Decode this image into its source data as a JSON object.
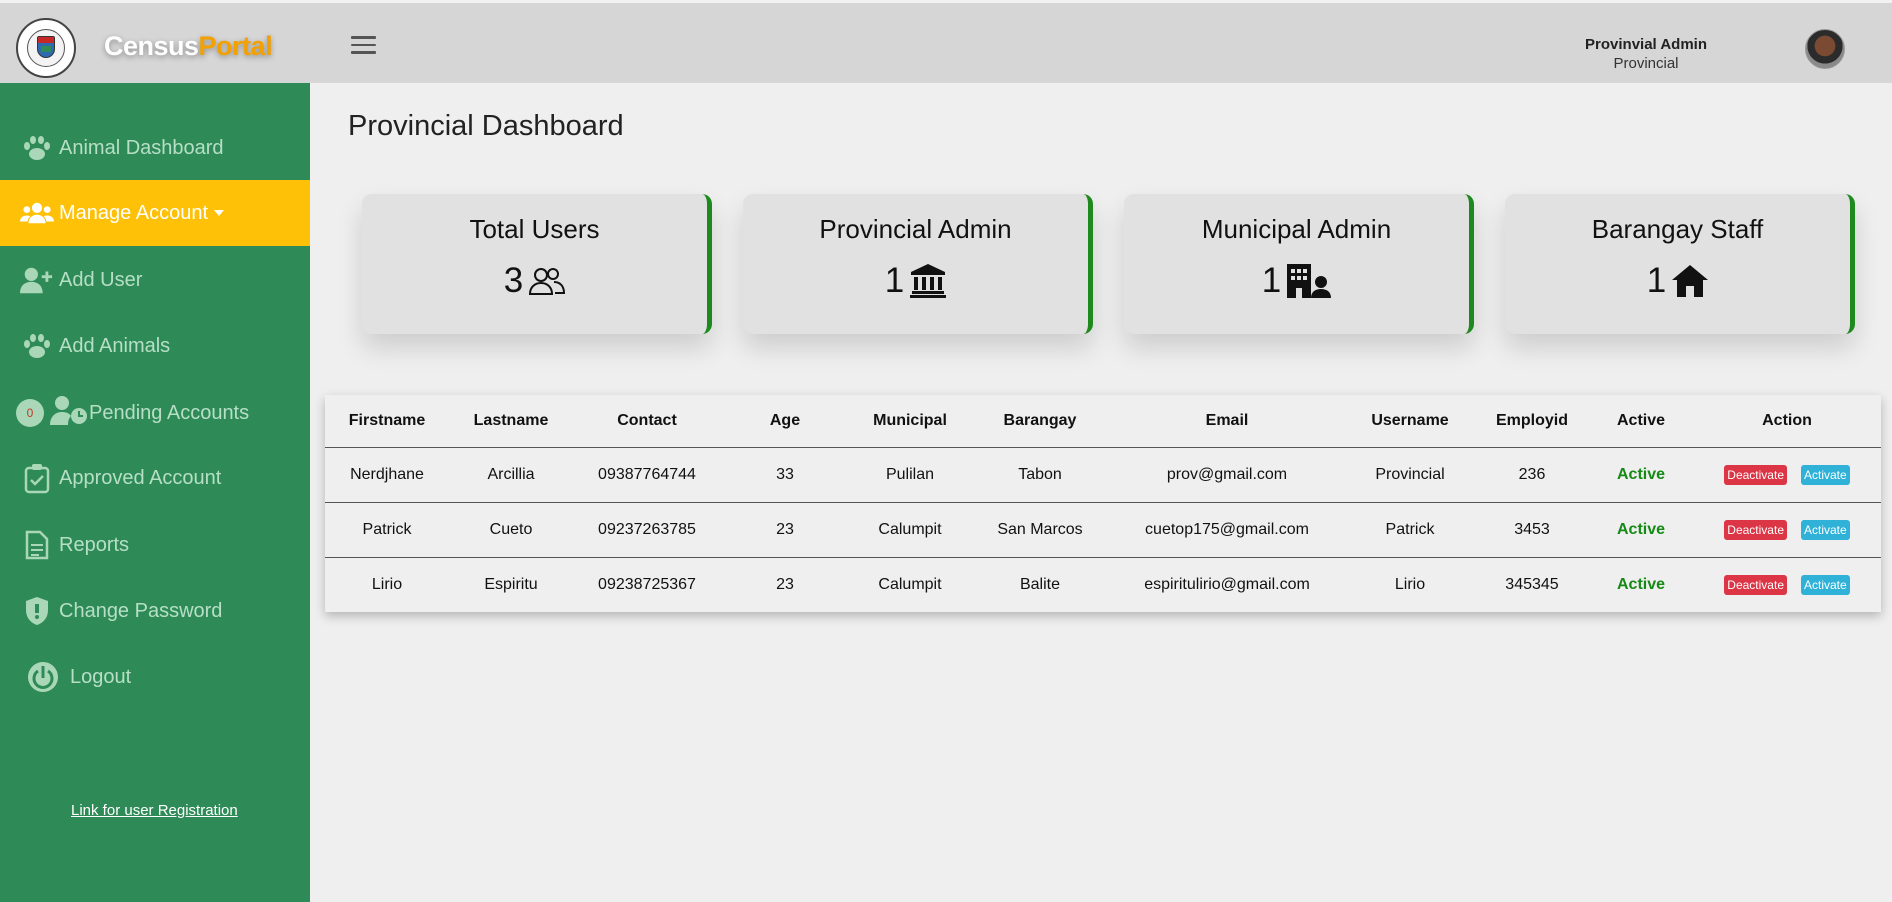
{
  "header": {
    "brand_part1": "Census",
    "brand_part2": "Portal",
    "user_name": "Provinvial Admin",
    "user_role": "Provincial"
  },
  "sidebar": {
    "items": [
      {
        "label": "Animal Dashboard",
        "icon": "paw-icon"
      },
      {
        "label": "Manage Account",
        "icon": "users-icon"
      },
      {
        "label": "Add User",
        "icon": "user-plus-icon"
      },
      {
        "label": "Add Animals",
        "icon": "paw-icon"
      },
      {
        "label": "Pending Accounts",
        "icon": "user-clock-icon",
        "badge": "0"
      },
      {
        "label": "Approved Account",
        "icon": "clipboard-check-icon"
      },
      {
        "label": "Reports",
        "icon": "file-icon"
      },
      {
        "label": "Change Password",
        "icon": "shield-icon"
      },
      {
        "label": "Logout",
        "icon": "power-icon"
      }
    ],
    "registration_link": "Link for user Registration"
  },
  "main": {
    "title": "Provincial Dashboard",
    "cards": [
      {
        "title": "Total Users",
        "value": "3",
        "icon": "user-group-icon"
      },
      {
        "title": "Provincial Admin",
        "value": "1",
        "icon": "building-columns-icon"
      },
      {
        "title": "Municipal Admin",
        "value": "1",
        "icon": "building-user-icon"
      },
      {
        "title": "Barangay Staff",
        "value": "1",
        "icon": "house-icon"
      }
    ],
    "table": {
      "headers": [
        "Firstname",
        "Lastname",
        "Contact",
        "Age",
        "Municipal",
        "Barangay",
        "Email",
        "Username",
        "Employid",
        "Active",
        "Action"
      ],
      "rows": [
        {
          "firstname": "Nerdjhane",
          "lastname": "Arcillia",
          "contact": "09387764744",
          "age": "33",
          "municipal": "Pulilan",
          "barangay": "Tabon",
          "email": "prov@gmail.com",
          "username": "Provincial",
          "employid": "236",
          "active": "Active"
        },
        {
          "firstname": "Patrick",
          "lastname": "Cueto",
          "contact": "09237263785",
          "age": "23",
          "municipal": "Calumpit",
          "barangay": "San Marcos",
          "email": "cuetop175@gmail.com",
          "username": "Patrick",
          "employid": "3453",
          "active": "Active"
        },
        {
          "firstname": "Lirio",
          "lastname": "Espiritu",
          "contact": "09238725367",
          "age": "23",
          "municipal": "Calumpit",
          "barangay": "Balite",
          "email": "espiritulirio@gmail.com",
          "username": "Lirio",
          "employid": "345345",
          "active": "Active"
        }
      ],
      "deactivate_label": "Deactivate",
      "activate_label": "Activate"
    }
  },
  "colors": {
    "sidebar": "#2e8b57",
    "active_nav": "#ffc107",
    "brand_accent": "#f2a100",
    "card_border": "#1e8a1e",
    "active_text": "#158a15",
    "deactivate": "#dc3545",
    "activate": "#2fb1d8"
  }
}
